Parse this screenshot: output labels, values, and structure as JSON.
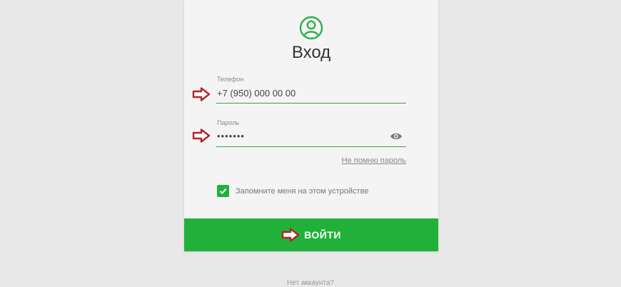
{
  "form": {
    "title": "Вход",
    "phone_label": "Телефон",
    "phone_value": "+7 (950) 000 00 00",
    "password_label": "Пароль",
    "password_value": "•••••••",
    "forgot_link": "Не помню пароль",
    "remember_label": "Запомните меня на этом устройстве",
    "remember_checked": true,
    "login_button": "ВОЙТИ",
    "no_account": "Нет аккаунта?"
  },
  "colors": {
    "accent": "#21b13b",
    "field_underline": "#3aa34a",
    "annotation_arrow": "#b3262a"
  },
  "icons": [
    "user-circle-icon",
    "eye-icon",
    "check-icon",
    "arrow-right-icon"
  ]
}
